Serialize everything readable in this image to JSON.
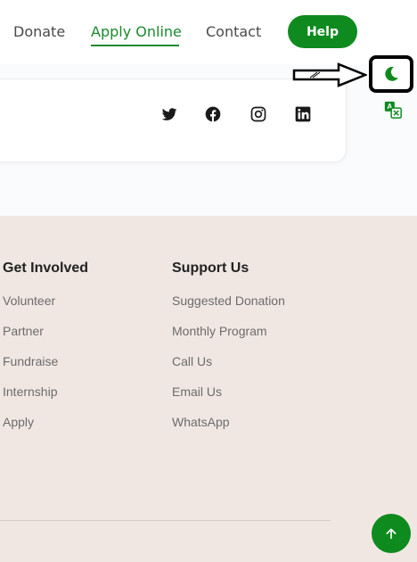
{
  "nav": {
    "links": [
      "Donate",
      "Apply Online",
      "Contact"
    ],
    "help_label": "Help"
  },
  "social": [
    "twitter-icon",
    "facebook-icon",
    "instagram-icon",
    "linkedin-icon"
  ],
  "footer": {
    "get_involved": {
      "title": "Get Involved",
      "items": [
        "Volunteer",
        "Partner",
        "Fundraise",
        "Internship",
        "Apply"
      ]
    },
    "support_us": {
      "title": "Support Us",
      "items": [
        "Suggested Donation",
        "Monthly Program",
        "Call Us",
        "Email Us",
        "WhatsApp"
      ]
    }
  },
  "colors": {
    "accent": "#0e8a1e",
    "footer_bg": "#f0e7e3"
  }
}
